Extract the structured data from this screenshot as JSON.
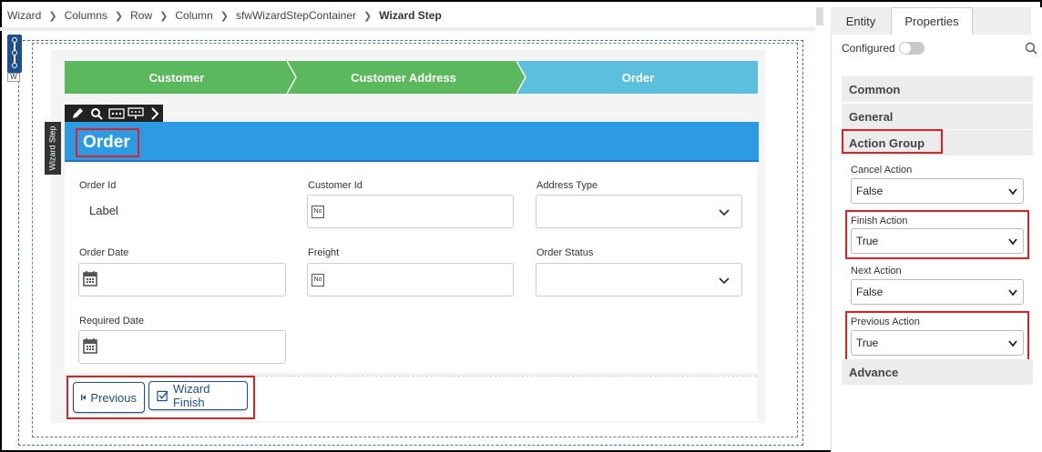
{
  "breadcrumb": [
    "Wizard",
    "Columns",
    "Row",
    "Column",
    "sfwWizardStepContainer",
    "Wizard Step"
  ],
  "widget_tag_text": "W",
  "stepper": {
    "steps": [
      "Customer",
      "Customer Address",
      "Order"
    ],
    "active_index": 2,
    "colors": {
      "done": "#5cb85c",
      "active": "#5bc0de"
    }
  },
  "toolbar_icons": [
    "pencil-icon",
    "search-icon",
    "ellipsis-box-icon",
    "insert-below-icon",
    "chevron-right-icon"
  ],
  "side_tab": "Wizard Step",
  "header": {
    "title": "Order",
    "color": "#2d9be3"
  },
  "form": {
    "order_id_label": "Order Id",
    "order_id_value": "Label",
    "customer_id_label": "Customer Id",
    "customer_id_badge": "No",
    "address_type_label": "Address Type",
    "order_date_label": "Order Date",
    "freight_label": "Freight",
    "freight_badge": "No",
    "order_status_label": "Order Status",
    "required_date_label": "Required Date"
  },
  "buttons": {
    "previous": "Previous",
    "finish": "Wizard Finish"
  },
  "right_panel": {
    "tabs": [
      "Entity",
      "Properties"
    ],
    "active_tab": "Properties",
    "configured_label": "Configured",
    "sections": [
      "Common",
      "General",
      "Action Group",
      "Advance"
    ],
    "properties": [
      {
        "label": "Cancel Action",
        "value": "False"
      },
      {
        "label": "Finish Action",
        "value": "True"
      },
      {
        "label": "Next Action",
        "value": "False"
      },
      {
        "label": "Previous Action",
        "value": "True"
      }
    ]
  },
  "highlight_color": "#e31e24"
}
